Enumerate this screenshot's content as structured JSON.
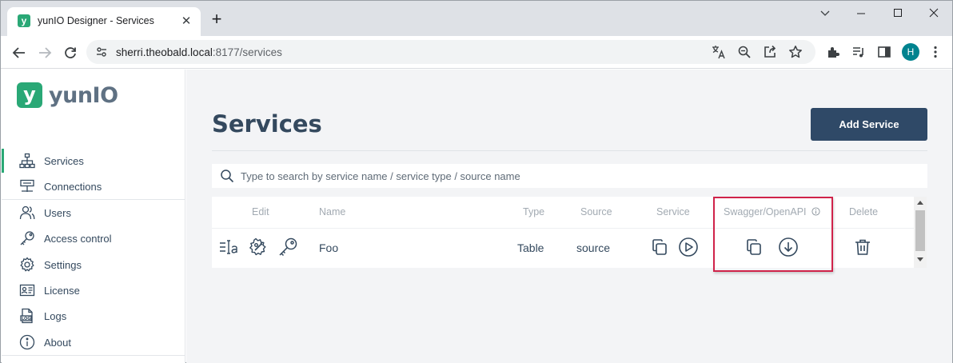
{
  "browser": {
    "tab_title": "yunIO Designer - Services",
    "url_host": "sherri.theobald.local",
    "url_rest": ":8177/services",
    "avatar_initial": "H",
    "favicon_letter": "y"
  },
  "brand": {
    "badge_letter": "y",
    "name": "yunIO",
    "accent": "#2aa876",
    "primary": "#2f4967"
  },
  "sidebar": {
    "items": [
      {
        "label": "Services",
        "icon": "sitemap-icon",
        "active": true
      },
      {
        "label": "Connections",
        "icon": "connections-icon"
      },
      {
        "label": "Users",
        "icon": "users-icon"
      },
      {
        "label": "Access control",
        "icon": "key-icon"
      },
      {
        "label": "Settings",
        "icon": "gear-icon"
      },
      {
        "label": "License",
        "icon": "id-card-icon"
      },
      {
        "label": "Logs",
        "icon": "log-file-icon"
      },
      {
        "label": "About",
        "icon": "info-icon"
      }
    ]
  },
  "main": {
    "title": "Services",
    "add_button": "Add Service",
    "search_placeholder": "Type to search by service name / service type / source name"
  },
  "table": {
    "headers": {
      "edit": "Edit",
      "name": "Name",
      "type": "Type",
      "source": "Source",
      "service": "Service",
      "swagger": "Swagger/OpenAPI",
      "delete": "Delete"
    },
    "rows": [
      {
        "name": "Foo",
        "type": "Table",
        "source": "source"
      }
    ]
  },
  "annotation": {
    "color": "#d0234a"
  }
}
